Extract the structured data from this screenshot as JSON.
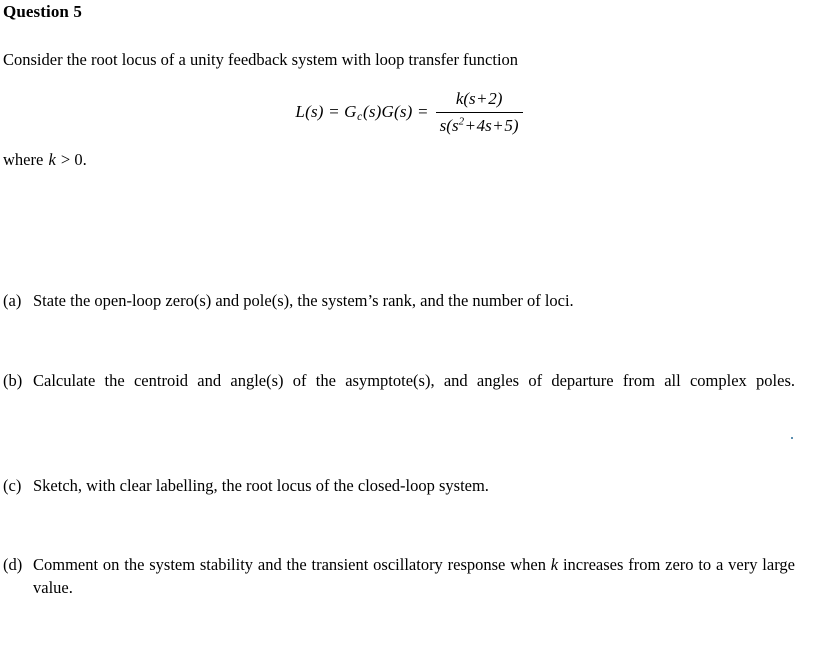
{
  "document": {
    "title": "Question 5",
    "intro": "Consider the root locus of a unity feedback system with loop transfer function",
    "where_prefix": "where ",
    "where_var": "k",
    "where_suffix": " > 0."
  },
  "equation": {
    "lhs": "L(s) = G",
    "lhs_sub": "c",
    "lhs_rest": "(s)G(s) =",
    "numerator_pre": "k(s",
    "numerator_op": "+",
    "numerator_post": "2)",
    "numerator_text": "k(s + 2)",
    "denominator_text": "s(s² + 4s + 5)",
    "denom_s1": "s(s",
    "denom_sup": "2",
    "denom_op1": "+",
    "denom_mid": "4s",
    "denom_op2": "+",
    "denom_end": "5)",
    "full_text": "L(s) = Gc(s)G(s) = k(s + 2) / (s(s^2 + 4s + 5))"
  },
  "items": [
    {
      "marker": "(a)",
      "text": "State the open-loop zero(s) and pole(s), the system’s rank, and the number of loci."
    },
    {
      "marker": "(b)",
      "text": "Calculate the centroid and angle(s) of the asymptote(s), and angles of departure from all complex poles."
    },
    {
      "marker": "(c)",
      "text": "Sketch, with clear labelling, the root locus of the closed-loop system."
    },
    {
      "marker": "(d)",
      "text_before_var": "Comment on the system stability and the transient oscillatory response when ",
      "var": "k",
      "text_after_var": " increases from zero to a very large value."
    }
  ],
  "colors": {
    "background": "#ffffff",
    "text": "#000000",
    "speck": "#5b8fb0"
  }
}
